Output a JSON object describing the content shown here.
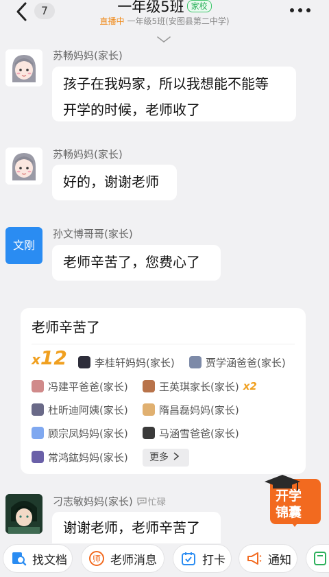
{
  "header": {
    "unread_count": "7",
    "title": "一年级5班",
    "tag": "家校",
    "live_label": "直播中",
    "subtitle": "一年级5班(安图县第二中学)"
  },
  "messages": [
    {
      "sender": "苏畅妈妈(家长)",
      "lines": [
        "孩子在我妈家，所以我想能不能等",
        "开学的时候，老师收了"
      ]
    },
    {
      "sender": "苏畅妈妈(家长)",
      "lines": [
        "好的，谢谢老师"
      ]
    },
    {
      "sender": "孙文博哥哥(家长)",
      "avatar_text": "文刚",
      "lines": [
        "老师辛苦了，您费心了"
      ]
    },
    {
      "sender": "刁志敏妈妈(家长)",
      "status": "忙碌",
      "lines": [
        "谢谢老师，老师辛苦了"
      ]
    }
  ],
  "praise_card": {
    "title": "老师辛苦了",
    "count_prefix": "x",
    "count": "12",
    "people": [
      {
        "name": "李桂轩妈妈(家长)",
        "color": "#2d2d3a"
      },
      {
        "name": "贾学涵爸爸(家长)",
        "color": "#7d8aa8"
      },
      {
        "name": "冯建平爸爸(家长)",
        "color": "#d08a8a"
      },
      {
        "name": "王英琪家长(家长)",
        "color": "#b8734a",
        "multiplier": "x2"
      },
      {
        "name": "杜昕迪阿姨(家长)",
        "color": "#6a6a88"
      },
      {
        "name": "隋昌磊妈妈(家长)",
        "color": "#e0b070"
      },
      {
        "name": "顾宗凤妈妈(家长)",
        "color": "#7fa8f0"
      },
      {
        "name": "马涵雪爸爸(家长)",
        "color": "#3a3a3a"
      },
      {
        "name": "常鸿鈜妈妈(家长)",
        "color": "#6a60a8"
      }
    ],
    "more_label": "更多"
  },
  "floating_badge": {
    "line1": "开学",
    "line2": "锦囊"
  },
  "toolbar": {
    "find_docs": "找文档",
    "teacher_msg": "老师消息",
    "checkin": "打卡",
    "notice": "通知"
  },
  "colors": {
    "accent_orange": "#f0a020",
    "tag_green": "#2bb05a",
    "brand_blue": "#2a8cf2"
  }
}
